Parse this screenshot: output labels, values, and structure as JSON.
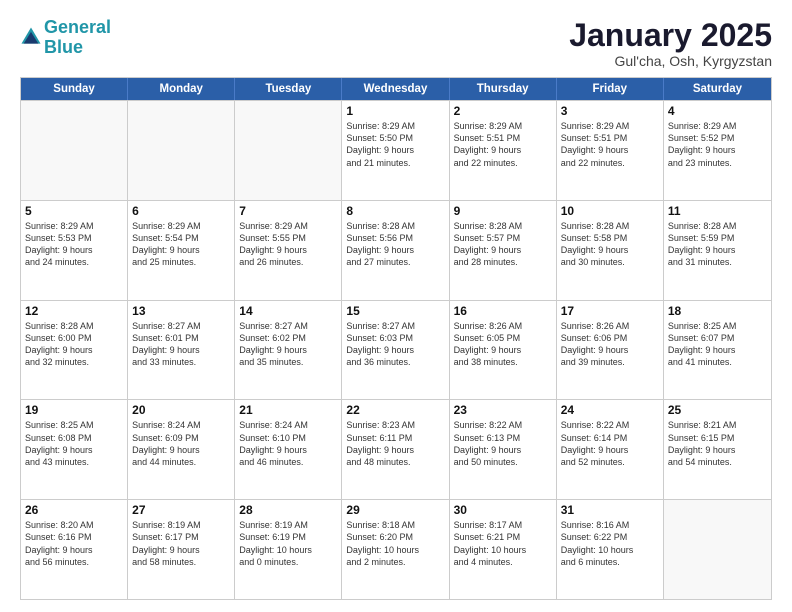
{
  "header": {
    "logo_line1": "General",
    "logo_line2": "Blue",
    "month": "January 2025",
    "location": "Gul'cha, Osh, Kyrgyzstan"
  },
  "days_of_week": [
    "Sunday",
    "Monday",
    "Tuesday",
    "Wednesday",
    "Thursday",
    "Friday",
    "Saturday"
  ],
  "weeks": [
    [
      {
        "day": "",
        "text": ""
      },
      {
        "day": "",
        "text": ""
      },
      {
        "day": "",
        "text": ""
      },
      {
        "day": "1",
        "text": "Sunrise: 8:29 AM\nSunset: 5:50 PM\nDaylight: 9 hours\nand 21 minutes."
      },
      {
        "day": "2",
        "text": "Sunrise: 8:29 AM\nSunset: 5:51 PM\nDaylight: 9 hours\nand 22 minutes."
      },
      {
        "day": "3",
        "text": "Sunrise: 8:29 AM\nSunset: 5:51 PM\nDaylight: 9 hours\nand 22 minutes."
      },
      {
        "day": "4",
        "text": "Sunrise: 8:29 AM\nSunset: 5:52 PM\nDaylight: 9 hours\nand 23 minutes."
      }
    ],
    [
      {
        "day": "5",
        "text": "Sunrise: 8:29 AM\nSunset: 5:53 PM\nDaylight: 9 hours\nand 24 minutes."
      },
      {
        "day": "6",
        "text": "Sunrise: 8:29 AM\nSunset: 5:54 PM\nDaylight: 9 hours\nand 25 minutes."
      },
      {
        "day": "7",
        "text": "Sunrise: 8:29 AM\nSunset: 5:55 PM\nDaylight: 9 hours\nand 26 minutes."
      },
      {
        "day": "8",
        "text": "Sunrise: 8:28 AM\nSunset: 5:56 PM\nDaylight: 9 hours\nand 27 minutes."
      },
      {
        "day": "9",
        "text": "Sunrise: 8:28 AM\nSunset: 5:57 PM\nDaylight: 9 hours\nand 28 minutes."
      },
      {
        "day": "10",
        "text": "Sunrise: 8:28 AM\nSunset: 5:58 PM\nDaylight: 9 hours\nand 30 minutes."
      },
      {
        "day": "11",
        "text": "Sunrise: 8:28 AM\nSunset: 5:59 PM\nDaylight: 9 hours\nand 31 minutes."
      }
    ],
    [
      {
        "day": "12",
        "text": "Sunrise: 8:28 AM\nSunset: 6:00 PM\nDaylight: 9 hours\nand 32 minutes."
      },
      {
        "day": "13",
        "text": "Sunrise: 8:27 AM\nSunset: 6:01 PM\nDaylight: 9 hours\nand 33 minutes."
      },
      {
        "day": "14",
        "text": "Sunrise: 8:27 AM\nSunset: 6:02 PM\nDaylight: 9 hours\nand 35 minutes."
      },
      {
        "day": "15",
        "text": "Sunrise: 8:27 AM\nSunset: 6:03 PM\nDaylight: 9 hours\nand 36 minutes."
      },
      {
        "day": "16",
        "text": "Sunrise: 8:26 AM\nSunset: 6:05 PM\nDaylight: 9 hours\nand 38 minutes."
      },
      {
        "day": "17",
        "text": "Sunrise: 8:26 AM\nSunset: 6:06 PM\nDaylight: 9 hours\nand 39 minutes."
      },
      {
        "day": "18",
        "text": "Sunrise: 8:25 AM\nSunset: 6:07 PM\nDaylight: 9 hours\nand 41 minutes."
      }
    ],
    [
      {
        "day": "19",
        "text": "Sunrise: 8:25 AM\nSunset: 6:08 PM\nDaylight: 9 hours\nand 43 minutes."
      },
      {
        "day": "20",
        "text": "Sunrise: 8:24 AM\nSunset: 6:09 PM\nDaylight: 9 hours\nand 44 minutes."
      },
      {
        "day": "21",
        "text": "Sunrise: 8:24 AM\nSunset: 6:10 PM\nDaylight: 9 hours\nand 46 minutes."
      },
      {
        "day": "22",
        "text": "Sunrise: 8:23 AM\nSunset: 6:11 PM\nDaylight: 9 hours\nand 48 minutes."
      },
      {
        "day": "23",
        "text": "Sunrise: 8:22 AM\nSunset: 6:13 PM\nDaylight: 9 hours\nand 50 minutes."
      },
      {
        "day": "24",
        "text": "Sunrise: 8:22 AM\nSunset: 6:14 PM\nDaylight: 9 hours\nand 52 minutes."
      },
      {
        "day": "25",
        "text": "Sunrise: 8:21 AM\nSunset: 6:15 PM\nDaylight: 9 hours\nand 54 minutes."
      }
    ],
    [
      {
        "day": "26",
        "text": "Sunrise: 8:20 AM\nSunset: 6:16 PM\nDaylight: 9 hours\nand 56 minutes."
      },
      {
        "day": "27",
        "text": "Sunrise: 8:19 AM\nSunset: 6:17 PM\nDaylight: 9 hours\nand 58 minutes."
      },
      {
        "day": "28",
        "text": "Sunrise: 8:19 AM\nSunset: 6:19 PM\nDaylight: 10 hours\nand 0 minutes."
      },
      {
        "day": "29",
        "text": "Sunrise: 8:18 AM\nSunset: 6:20 PM\nDaylight: 10 hours\nand 2 minutes."
      },
      {
        "day": "30",
        "text": "Sunrise: 8:17 AM\nSunset: 6:21 PM\nDaylight: 10 hours\nand 4 minutes."
      },
      {
        "day": "31",
        "text": "Sunrise: 8:16 AM\nSunset: 6:22 PM\nDaylight: 10 hours\nand 6 minutes."
      },
      {
        "day": "",
        "text": ""
      }
    ]
  ]
}
